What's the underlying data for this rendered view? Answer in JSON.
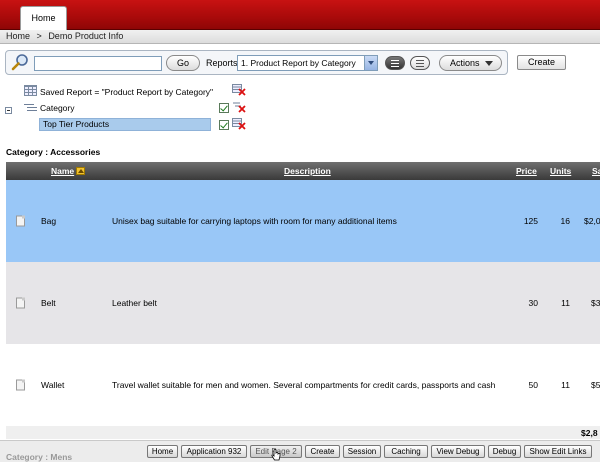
{
  "tabs": [
    {
      "label": "Home",
      "active": true
    }
  ],
  "breadcrumb": {
    "items": [
      "Home",
      ">",
      "Demo Product Info"
    ]
  },
  "toolbar": {
    "search_value": "",
    "go_label": "Go",
    "reports_label": "Reports",
    "reports_selected": "1. Product Report by Category",
    "actions_label": "Actions",
    "create_label": "Create"
  },
  "filters": {
    "saved_report": "Saved Report = \"Product Report by Category\"",
    "control_break": "Category",
    "highlight": "Top Tier Products"
  },
  "category_heading": "Category : Accessories",
  "table": {
    "columns": [
      "Name",
      "Description",
      "Price",
      "Units",
      "Sa"
    ],
    "rows": [
      {
        "name": "Bag",
        "description": "Unisex bag suitable for carrying laptops with room for many additional items",
        "price": "125",
        "units": "16",
        "sales": "$2,0",
        "highlighted": true
      },
      {
        "name": "Belt",
        "description": "Leather belt",
        "price": "30",
        "units": "11",
        "sales": "$3",
        "highlighted": false
      },
      {
        "name": "Wallet",
        "description": "Travel wallet suitable for men and women. Several compartments for credit cards, passports and cash",
        "price": "50",
        "units": "11",
        "sales": "$5",
        "highlighted": false
      }
    ],
    "sum": "$2,8"
  },
  "dev_bar": {
    "category_partial": "Category : Mens",
    "buttons": [
      "Home",
      "Application 932",
      "Edit Page 2",
      "Create",
      "Session",
      "Caching",
      "View Debug",
      "Debug",
      "Show Edit Links"
    ]
  },
  "colors": {
    "accent_red": "#a80a0a",
    "highlight_row": "#99c7f7",
    "alt_row": "#e6e5e8",
    "header_dark": "#3a3a3a"
  }
}
